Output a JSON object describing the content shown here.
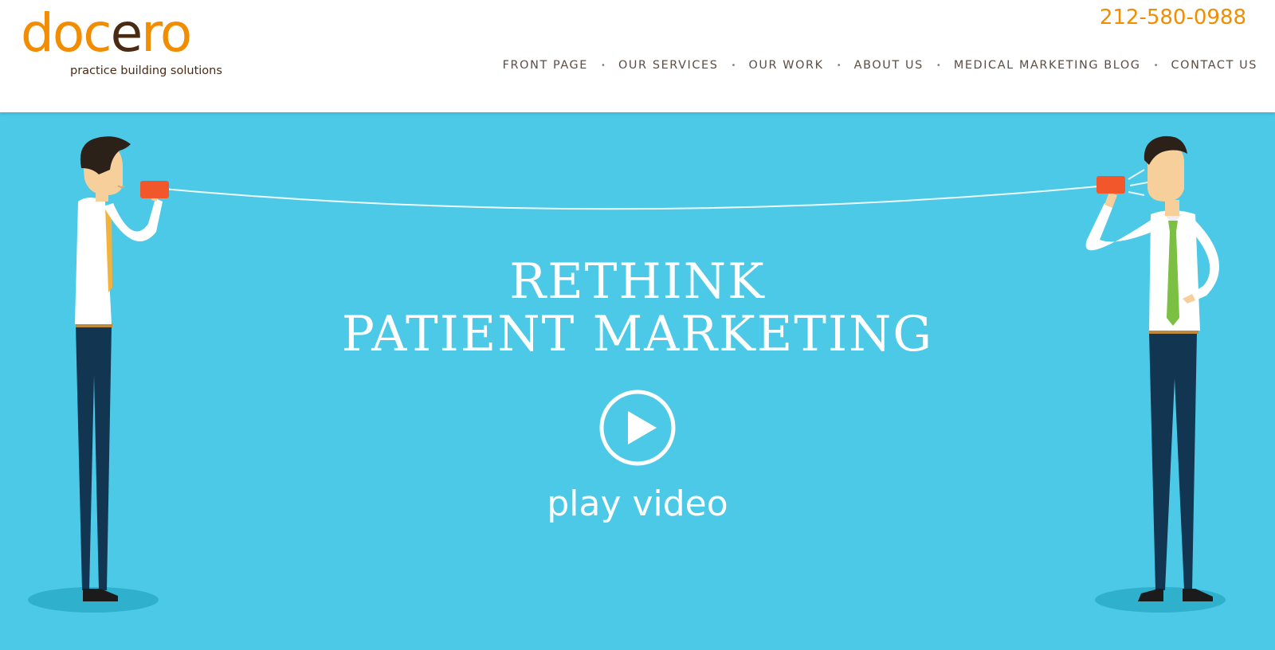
{
  "brand": {
    "logo_prefix": "doc",
    "logo_mid": "e",
    "logo_suffix": "ro",
    "tagline": "practice building solutions",
    "accent_color": "#f28c00",
    "dark_color": "#4b2a14"
  },
  "header": {
    "phone": "212-580-0988"
  },
  "nav": {
    "items": [
      {
        "label": "FRONT PAGE"
      },
      {
        "label": "OUR SERVICES"
      },
      {
        "label": "OUR WORK"
      },
      {
        "label": "ABOUT US"
      },
      {
        "label": "MEDICAL MARKETING BLOG"
      },
      {
        "label": "CONTACT US"
      }
    ],
    "separator": "•"
  },
  "hero": {
    "background_color": "#4cc9e6",
    "headline_line1": "RETHINK",
    "headline_line2": "PATIENT MARKETING",
    "play_icon": "play-circle-icon",
    "play_label": "play video",
    "illustration": "two businessmen talking through tin-can telephone"
  }
}
